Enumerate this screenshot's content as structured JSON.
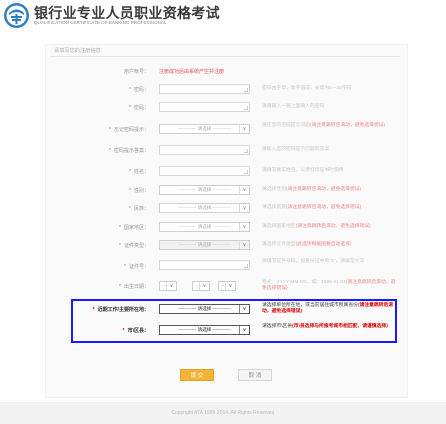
{
  "header": {
    "title": "银行业专业人员职业资格考试",
    "subtitle": "QUALIFICATION CERTIFICATE OF BANKING PROFESSIONAL"
  },
  "form": {
    "section_title": "请填写您的注册信息",
    "rows": [
      {
        "label": "用户帐号",
        "required": false,
        "value": "注册成功后由系统产生并注册",
        "hint": ""
      },
      {
        "label": "密码",
        "required": true,
        "value": "",
        "hint": "密码由字母，数字组成，长度为8～20字符"
      },
      {
        "label": "密码",
        "required": true,
        "value": "",
        "hint": "请再输入一遍上面输入的密码"
      },
      {
        "label": "忘记密码提示",
        "required": true,
        "value": "------------ 请选择 ------------",
        "hint_plain": "请在您的密码提示问题",
        "hint_red": "(请注意跳转后滚动，避免选择错误)"
      },
      {
        "label": "密码提示答案",
        "required": true,
        "value": "",
        "hint": "请输入您的密码提示问题的答案"
      },
      {
        "label": "姓名",
        "required": true,
        "value": "",
        "hint": "请填写真实姓名，以便打印证书时使用"
      },
      {
        "label": "性别",
        "required": true,
        "value": "------------ 请选择 ------------",
        "hint_plain": "请选择性别",
        "hint_red": "(请注意跳转后滚动，避免选择错误)"
      },
      {
        "label": "民族",
        "required": true,
        "value": "------------ 请选择 ------------",
        "hint_plain": "请选择民族",
        "hint_red": "(请注意跳转后滚动，避免选择错误)"
      },
      {
        "label": "国家地区",
        "required": true,
        "value": "------------ 请选择 ------------",
        "hint_plain": "请选择国家地区",
        "hint_red": "(请注意跳转后滚动，避免选择错误)"
      },
      {
        "label": "证件类型",
        "required": true,
        "value": "------------ 请选择 ------------",
        "hint_plain": "请选择证件类型",
        "hint_red": "(此选项根据国籍自动选择)"
      },
      {
        "label": "证件号",
        "required": true,
        "value": "",
        "hint": "请填写证件号码，如身份证中有“X”，请填写大写"
      },
      {
        "label": "出生日期",
        "required": true,
        "date_selects": [
          "----",
          "--",
          "--"
        ],
        "hint_plain": "格式：YYYY-MM-DD，如：1985-01-01",
        "hint_red": "(请注意跳转后滚动，避免选择错误)"
      }
    ],
    "highlighted_rows": [
      {
        "label": "近期工作/主要所在地",
        "required": true,
        "value": "------------ 请选择 ------------",
        "hint_plain": "请选择单位所在地，或当前居住城市所属省份(",
        "hint_red": "请注意跳转后滚动，避免选择错误)"
      },
      {
        "label": "市\\区县",
        "required": true,
        "value": "------------ 请选择 ------------",
        "hint_plain": "请选择市\\区县",
        "hint_red": "(市\\县选择与所报考城市相匹配，请谨慎选择)"
      }
    ],
    "buttons": {
      "submit": "提  交",
      "cancel": "取  消"
    }
  },
  "footer": {
    "copyright": "Copyright ATA 1999-2014. All Rights Reserved"
  },
  "colors": {
    "highlight_border": "#1a1aff",
    "submit": "#f3b33a",
    "required_star": "#e06060"
  }
}
